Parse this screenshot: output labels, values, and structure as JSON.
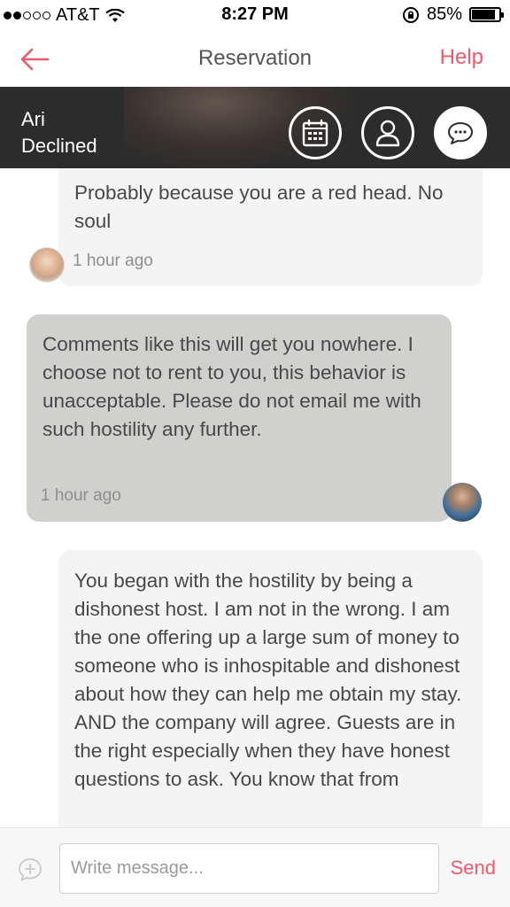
{
  "status_bar": {
    "carrier": "AT&T",
    "time": "8:27 PM",
    "battery": "85%"
  },
  "nav": {
    "title": "Reservation",
    "help_label": "Help"
  },
  "host": {
    "name": "Ari",
    "status": "Declined"
  },
  "messages": [
    {
      "text": "Probably because you are a red head. No soul",
      "time": "1 hour ago",
      "from": "guest"
    },
    {
      "text": "Comments like this will get you nowhere.  I choose not to rent to you, this behavior is unacceptable. Please do not email me with such hostility any further.",
      "time": "1 hour ago",
      "from": "host"
    },
    {
      "text": "You began with the hostility by being a dishonest host. I am not in the wrong. I am the one offering up a large sum of money to someone who is inhospitable and dishonest about how they can help me obtain my stay. AND the company will agree. Guests are in the right especially when they have honest questions to ask. You know that from",
      "time": "",
      "from": "guest"
    }
  ],
  "composer": {
    "placeholder": "Write message...",
    "send_label": "Send"
  },
  "colors": {
    "accent": "#ee5a6a",
    "banner": "#2c2c2c",
    "incoming_bubble": "#f4f4f4",
    "outgoing_bubble": "#d0d0ce"
  }
}
